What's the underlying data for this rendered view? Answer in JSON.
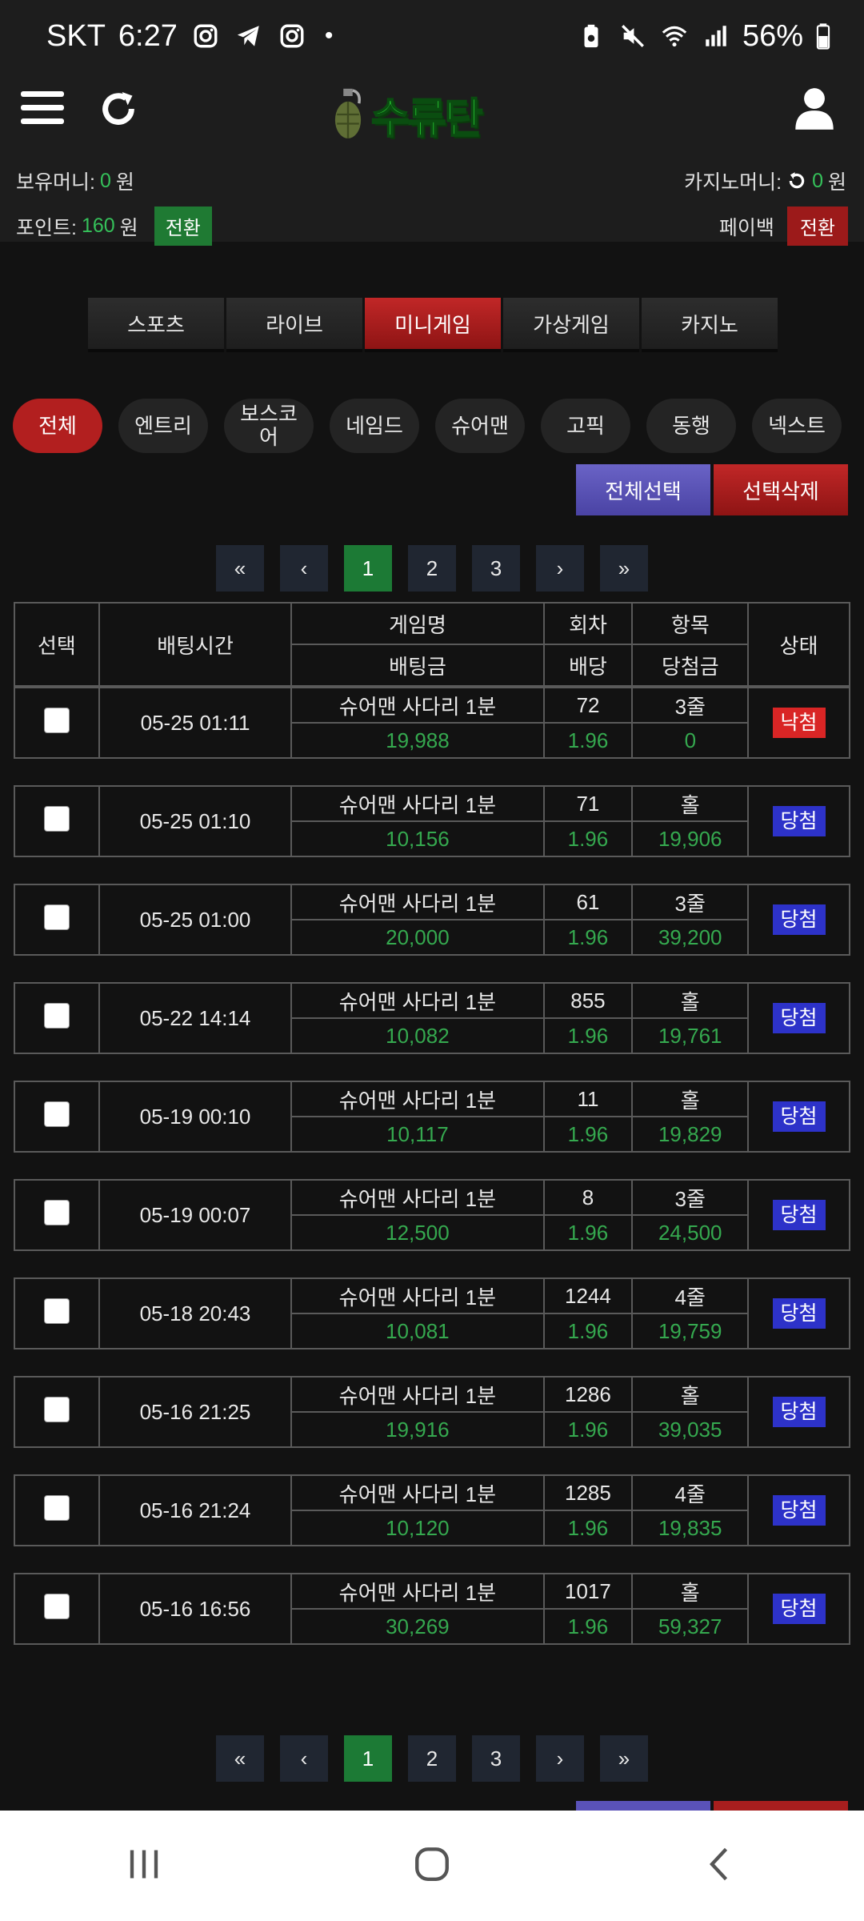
{
  "status_bar": {
    "carrier": "SKT",
    "time": "6:27",
    "dot": "•",
    "battery": "56%"
  },
  "header": {
    "logo_text": "수류탄"
  },
  "wallet": {
    "holding_label": "보유머니:",
    "holding_value": "0",
    "holding_unit": "원",
    "casino_label": "카지노머니:",
    "casino_value": "0",
    "casino_unit": "원",
    "points_label": "포인트:",
    "points_value": "160",
    "points_unit": "원",
    "convert_label": "전환",
    "payback_label": "페이백",
    "payback_convert_label": "전환"
  },
  "main_tabs": [
    "스포츠",
    "라이브",
    "미니게임",
    "가상게임",
    "카지노"
  ],
  "sub_tabs": [
    "전체",
    "엔트리",
    "보스코\n어",
    "네임드",
    "슈어맨",
    "고픽",
    "동행",
    "넥스트"
  ],
  "actions": {
    "select_all": "전체선택",
    "delete_selected": "선택삭제"
  },
  "pagination": {
    "first": "«",
    "prev": "‹",
    "pages": [
      "1",
      "2",
      "3"
    ],
    "next": "›",
    "last": "»"
  },
  "table": {
    "headers": {
      "select": "선택",
      "bet_time": "배팅시간",
      "game_name": "게임명",
      "bet_amount": "배팅금",
      "round": "회차",
      "odds": "배당",
      "item": "항목",
      "win_amount": "당첨금",
      "status": "상태"
    },
    "rows": [
      {
        "time": "05-25 01:11",
        "game": "슈어맨 사다리 1분",
        "amount": "19,988",
        "round": "72",
        "odds": "1.96",
        "item": "3줄",
        "win": "0",
        "status": "낙첨",
        "result": "lose"
      },
      {
        "time": "05-25 01:10",
        "game": "슈어맨 사다리 1분",
        "amount": "10,156",
        "round": "71",
        "odds": "1.96",
        "item": "홀",
        "win": "19,906",
        "status": "당첨",
        "result": "win"
      },
      {
        "time": "05-25 01:00",
        "game": "슈어맨 사다리 1분",
        "amount": "20,000",
        "round": "61",
        "odds": "1.96",
        "item": "3줄",
        "win": "39,200",
        "status": "당첨",
        "result": "win"
      },
      {
        "time": "05-22 14:14",
        "game": "슈어맨 사다리 1분",
        "amount": "10,082",
        "round": "855",
        "odds": "1.96",
        "item": "홀",
        "win": "19,761",
        "status": "당첨",
        "result": "win"
      },
      {
        "time": "05-19 00:10",
        "game": "슈어맨 사다리 1분",
        "amount": "10,117",
        "round": "11",
        "odds": "1.96",
        "item": "홀",
        "win": "19,829",
        "status": "당첨",
        "result": "win"
      },
      {
        "time": "05-19 00:07",
        "game": "슈어맨 사다리 1분",
        "amount": "12,500",
        "round": "8",
        "odds": "1.96",
        "item": "3줄",
        "win": "24,500",
        "status": "당첨",
        "result": "win"
      },
      {
        "time": "05-18 20:43",
        "game": "슈어맨 사다리 1분",
        "amount": "10,081",
        "round": "1244",
        "odds": "1.96",
        "item": "4줄",
        "win": "19,759",
        "status": "당첨",
        "result": "win"
      },
      {
        "time": "05-16 21:25",
        "game": "슈어맨 사다리 1분",
        "amount": "19,916",
        "round": "1286",
        "odds": "1.96",
        "item": "홀",
        "win": "39,035",
        "status": "당첨",
        "result": "win"
      },
      {
        "time": "05-16 21:24",
        "game": "슈어맨 사다리 1분",
        "amount": "10,120",
        "round": "1285",
        "odds": "1.96",
        "item": "4줄",
        "win": "19,835",
        "status": "당첨",
        "result": "win"
      },
      {
        "time": "05-16 16:56",
        "game": "슈어맨 사다리 1분",
        "amount": "30,269",
        "round": "1017",
        "odds": "1.96",
        "item": "홀",
        "win": "59,327",
        "status": "당첨",
        "result": "win"
      }
    ]
  },
  "colors": {
    "accent_green": "#35c15a",
    "accent_red": "#b21f1f",
    "win_blue": "#2d32c9",
    "lose_red": "#d92525"
  }
}
